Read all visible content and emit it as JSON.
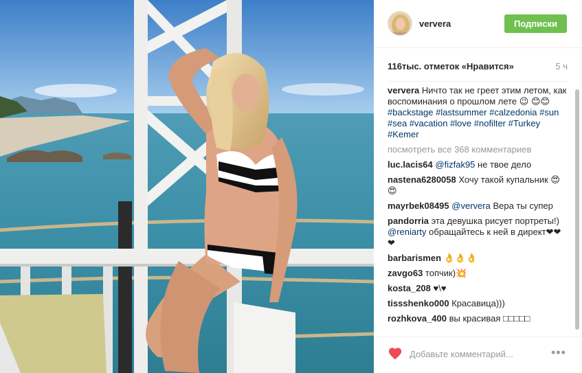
{
  "header": {
    "username": "ververa",
    "follow_label": "Подписки"
  },
  "post": {
    "likes": "116тыс. отметок «Нравится»",
    "time_ago": "5 ч"
  },
  "caption": {
    "user": "ververa",
    "text": "Ничто так не греет этим летом, как воспоминания о прошлом лете 😉 😊😊",
    "hashtags": "#backstage #lastsummer #calzedonia #sun #sea #vacation #love #nofilter #Turkey #Kemer"
  },
  "view_all": "посмотреть все 368 комментариев",
  "comments": [
    {
      "user": "luc.lacis64",
      "mention": "@fizfak95",
      "text": "не твое дело"
    },
    {
      "user": "nastena6280058",
      "mention": "",
      "text": "Хочу такой купальник 😍😍"
    },
    {
      "user": "mayrbek08495",
      "mention": "@ververa",
      "text": "Вера ты супер"
    },
    {
      "user": "pandorria",
      "mention": "@reniarty",
      "text_before": "эта девушка рисует портреты!)",
      "text": "обращайтесь к ней в директ❤❤❤"
    },
    {
      "user": "barbarismen",
      "mention": "",
      "text": "👌👌👌"
    },
    {
      "user": "zavgo63",
      "mention": "",
      "text": "топчик)💥"
    },
    {
      "user": "kosta_208",
      "mention": "",
      "text": "♥\\♥"
    },
    {
      "user": "tissshenko000",
      "mention": "",
      "text": "Красавица)))"
    },
    {
      "user": "rozhkova_400",
      "mention": "",
      "text": "вы красивая □□□□□"
    }
  ],
  "footer": {
    "add_comment_placeholder": "Добавьте комментарий...",
    "more_label": "•••"
  },
  "colors": {
    "follow": "#70c050",
    "link": "#003569",
    "like": "#ed4956"
  },
  "icons": {
    "like": "heart-icon",
    "more": "more-options-icon"
  }
}
